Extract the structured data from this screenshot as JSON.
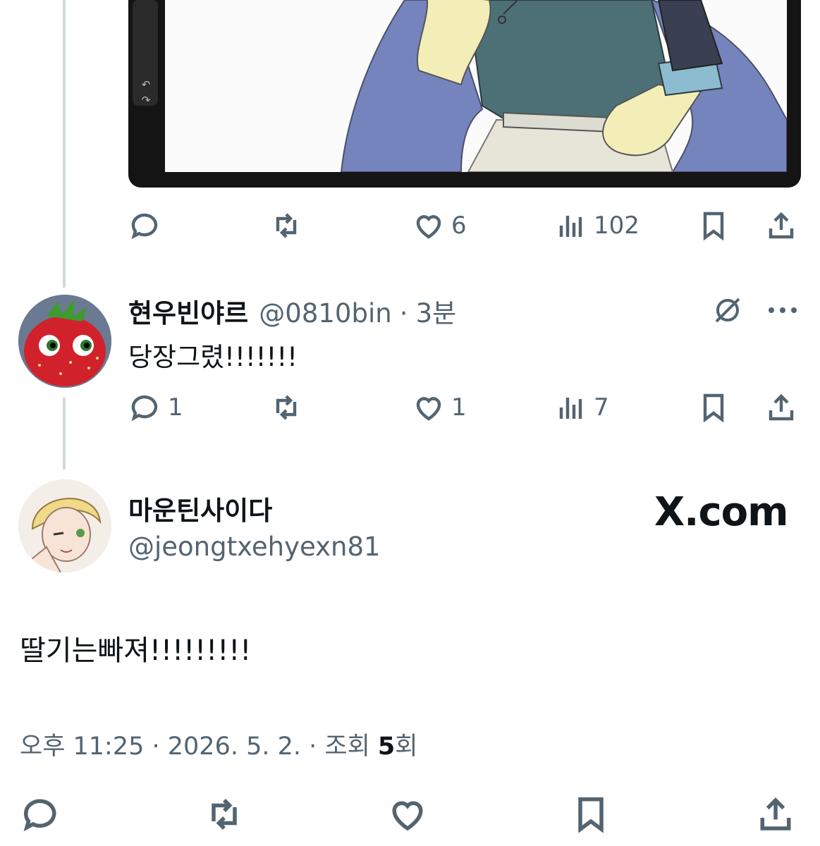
{
  "tweet": {
    "actions": {
      "reply_count": "",
      "retweet_count": "",
      "like_count": "6",
      "views_count": "102"
    }
  },
  "reply": {
    "author_name": "현우빈야르",
    "author_handle": "@0810bin",
    "separator": "·",
    "time": "3분",
    "text": "당장그렸!!!!!!!",
    "actions": {
      "reply_count": "1",
      "retweet_count": "",
      "like_count": "1",
      "views_count": "7"
    }
  },
  "main": {
    "author_name": "마운틴사이다",
    "author_handle": "@jeongtxehyexn81",
    "text": "딸기는빠져!!!!!!!!!",
    "meta_prefix": "오후 11:25 · 2026. 5. 2. · 조회 ",
    "views_value": "5",
    "views_suffix": "회",
    "watermark": "X.com"
  },
  "icons": {
    "reply": "reply-icon",
    "retweet": "retweet-icon",
    "like": "heart-icon",
    "views": "views-icon",
    "bookmark": "bookmark-icon",
    "share": "share-icon",
    "grok": "grok-icon",
    "more": "more-icon"
  }
}
